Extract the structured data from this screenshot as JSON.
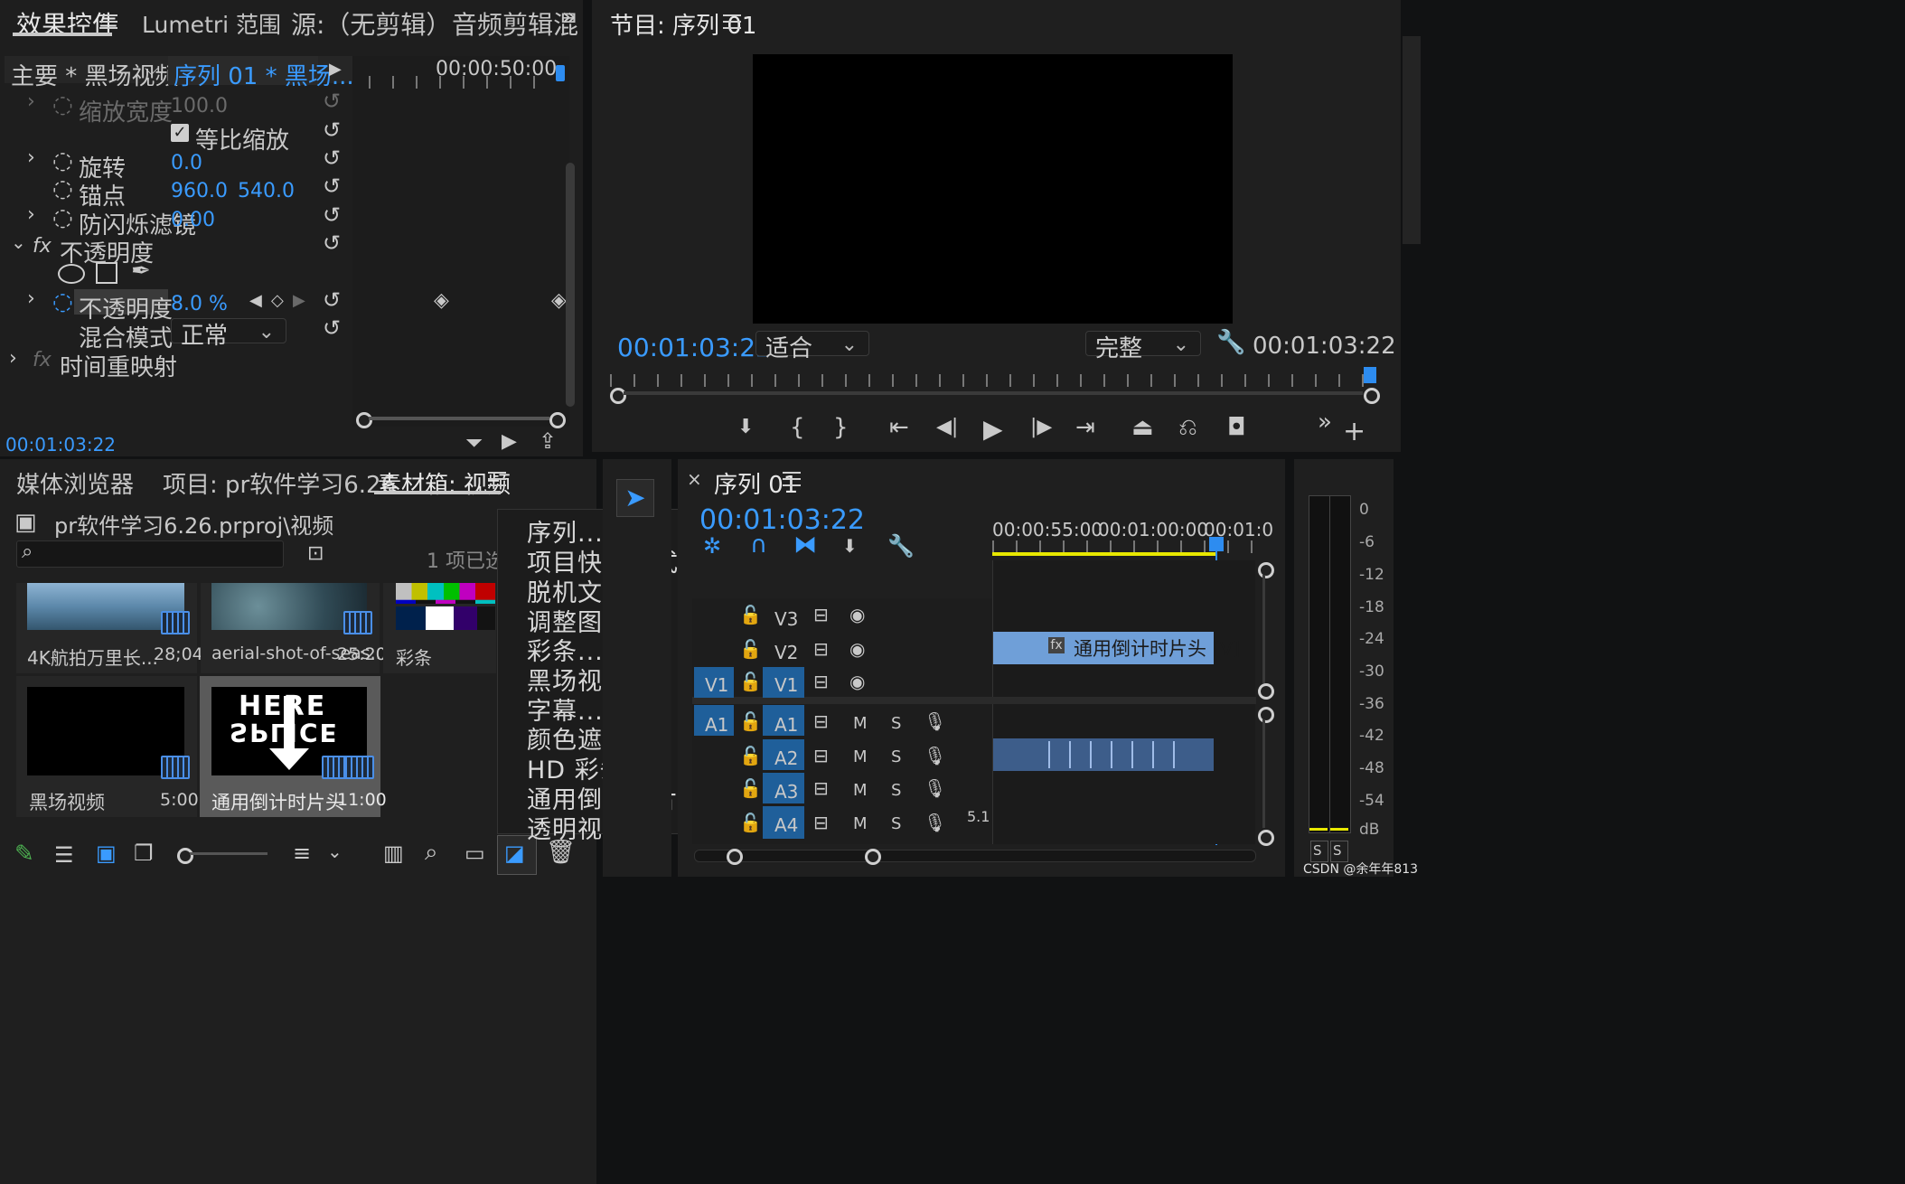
{
  "effect_controls": {
    "tabs": [
      "效果控件",
      "Lumetri 范围",
      "源:（无剪辑）",
      "音频剪辑混"
    ],
    "master_clip": "主要 * 黑场视频",
    "sequence_clip": "序列 01 * 黑场...",
    "timeline_time": "00:00:50:00",
    "properties": {
      "scale_width": {
        "label": "缩放宽度",
        "value": "100.0"
      },
      "uniform_scale": "等比缩放",
      "rotation": {
        "label": "旋转",
        "value": "0.0"
      },
      "anchor": {
        "label": "锚点",
        "x": "960.0",
        "y": "540.0"
      },
      "antiflicker": {
        "label": "防闪烁滤镜",
        "value": "0.00"
      },
      "opacity_group": "不透明度",
      "opacity": {
        "label": "不透明度",
        "value": "8.0 %"
      },
      "blend_mode": {
        "label": "混合模式",
        "value": "正常"
      },
      "time_remap": "时间重映射",
      "fx": "fx"
    },
    "current_time": "00:01:03:22"
  },
  "program_monitor": {
    "title": "节目: 序列 01",
    "timecode_left": "00:01:03:22",
    "fit": "适合",
    "quality": "完整",
    "timecode_right": "00:01:03:22"
  },
  "project_panel": {
    "tabs": [
      "媒体浏览器",
      "项目: pr软件学习6.26",
      "素材箱: 视频"
    ],
    "path": "pr软件学习6.26.prproj\\视频",
    "selection": "1 项已选",
    "items": [
      {
        "name": "4K航拍万里长...",
        "duration": "28;04"
      },
      {
        "name": "aerial-shot-of-seas...",
        "duration": "25:20"
      },
      {
        "name": "彩条",
        "duration": ""
      },
      {
        "name": "黑场视频",
        "duration": "5:00"
      },
      {
        "name": "通用倒计时片头",
        "duration": "11:00"
      }
    ],
    "countdown_thumb_top": "HERE",
    "countdown_thumb_bottom": "SPLICE"
  },
  "new_item_menu": [
    "序列...",
    "项目快捷方式...",
    "脱机文件...",
    "调整图层...",
    "彩条...",
    "黑场视频...",
    "字幕...",
    "颜色遮罩...",
    "HD 彩条...",
    "通用倒计时片头...",
    "透明视频..."
  ],
  "timeline": {
    "title": "序列 01",
    "timecode": "00:01:03:22",
    "ruler": [
      "00:00:55:00",
      "00:01:00:00",
      "00:01:0"
    ],
    "video_tracks": [
      "V3",
      "V2",
      "V1"
    ],
    "audio_tracks": [
      "A1",
      "A2",
      "A3",
      "A4"
    ],
    "source_v": "V1",
    "source_a": "A1",
    "clip_v2": "通用倒计时片头 [V]",
    "mute": "M",
    "solo": "S",
    "a4_channels": "5.1",
    "fx": "fx"
  },
  "audio_meter": {
    "scale": [
      "0",
      "-6",
      "-12",
      "-18",
      "-24",
      "-30",
      "-36",
      "-42",
      "-48",
      "-54",
      "dB"
    ],
    "solo_left": "S",
    "solo_right": "S"
  },
  "watermark": "CSDN @余年年813"
}
